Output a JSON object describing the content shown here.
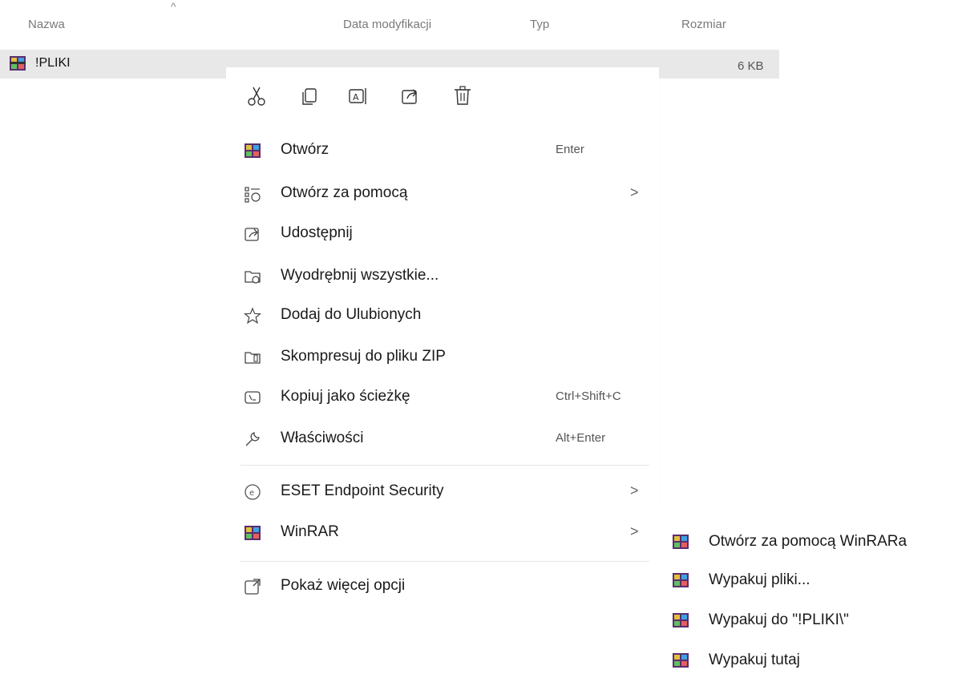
{
  "columns": {
    "name": "Nazwa",
    "date": "Data modyfikacji",
    "type": "Typ",
    "size": "Rozmiar"
  },
  "file": {
    "name": "!PLIKI",
    "size": "6 KB",
    "icon": "winrar-archive-icon"
  },
  "toolbar": [
    {
      "name": "cut",
      "icon": "scissors-icon"
    },
    {
      "name": "copy",
      "icon": "copy-icon"
    },
    {
      "name": "rename",
      "icon": "rename-icon"
    },
    {
      "name": "share",
      "icon": "share-icon"
    },
    {
      "name": "delete",
      "icon": "trash-icon"
    }
  ],
  "menu": {
    "open": {
      "label": "Otwórz",
      "shortcut": "Enter"
    },
    "open_with": {
      "label": "Otwórz za pomocą",
      "chevron": ">"
    },
    "share": {
      "label": "Udostępnij"
    },
    "extract_all": {
      "label": "Wyodrębnij wszystkie..."
    },
    "favorites": {
      "label": "Dodaj do Ulubionych"
    },
    "compress_zip": {
      "label": "Skompresuj do pliku ZIP"
    },
    "copy_path": {
      "label": "Kopiuj jako ścieżkę",
      "shortcut": "Ctrl+Shift+C"
    },
    "properties": {
      "label": "Właściwości",
      "shortcut": "Alt+Enter"
    },
    "eset": {
      "label": "ESET Endpoint Security",
      "chevron": ">"
    },
    "winrar": {
      "label": "WinRAR",
      "chevron": ">"
    },
    "more_options": {
      "label": "Pokaż więcej opcji"
    }
  },
  "submenu": {
    "open_winrar": {
      "label": "Otwórz za pomocą WinRARa"
    },
    "extract_files": {
      "label": "Wypakuj pliki..."
    },
    "extract_to": {
      "label": "Wypakuj do \"!PLIKI\\\""
    },
    "extract_here": {
      "label": "Wypakuj tutaj"
    }
  },
  "colors": {
    "selected_row": "#e8e8e8",
    "text": "#1a1a1a",
    "muted": "#7a7a7a"
  }
}
